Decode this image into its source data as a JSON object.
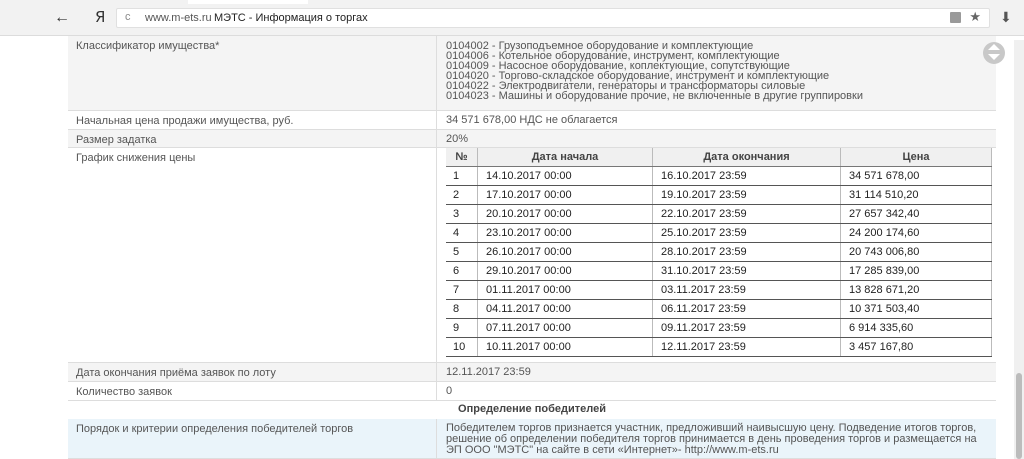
{
  "browser": {
    "back_icon": "←",
    "yandex_logo": "Я",
    "reload_icon": "c",
    "domain": "www.m-ets.ru",
    "title": "МЭТС - Информация о торгах",
    "star_icon": "★",
    "download_icon": "⬇"
  },
  "lot": {
    "classifier_label": "Классификатор имущества*",
    "classifier_items": [
      "0104002 - Грузоподъемное оборудование и комплектующие",
      "0104006 - Котельное оборудование, инструмент, комплектующие",
      "0104009 - Насосное оборудование, коплектующие, сопутствующие",
      "0104020 - Торгово-складское оборудование, инструмент и комплектующие",
      "0104022 - Электродвигатели, генераторы и трансформаторы силовые",
      "0104023 - Машины и оборудование прочие, не включенные в другие группировки"
    ],
    "start_price_label": "Начальная цена продажи имущества, руб.",
    "start_price_value": "34 571 678,00 НДС не облагается",
    "deposit_label": "Размер задатка",
    "deposit_value": "20%",
    "schedule_label": "График снижения цены",
    "schedule_headers": {
      "num": "№",
      "start": "Дата начала",
      "end": "Дата окончания",
      "price": "Цена"
    },
    "schedule": [
      {
        "num": "1",
        "start": "14.10.2017 00:00",
        "end": "16.10.2017 23:59",
        "price": "34 571 678,00"
      },
      {
        "num": "2",
        "start": "17.10.2017 00:00",
        "end": "19.10.2017 23:59",
        "price": "31 114 510,20"
      },
      {
        "num": "3",
        "start": "20.10.2017 00:00",
        "end": "22.10.2017 23:59",
        "price": "27 657 342,40"
      },
      {
        "num": "4",
        "start": "23.10.2017 00:00",
        "end": "25.10.2017 23:59",
        "price": "24 200 174,60"
      },
      {
        "num": "5",
        "start": "26.10.2017 00:00",
        "end": "28.10.2017 23:59",
        "price": "20 743 006,80"
      },
      {
        "num": "6",
        "start": "29.10.2017 00:00",
        "end": "31.10.2017 23:59",
        "price": "17 285 839,00"
      },
      {
        "num": "7",
        "start": "01.11.2017 00:00",
        "end": "03.11.2017 23:59",
        "price": "13 828 671,20"
      },
      {
        "num": "8",
        "start": "04.11.2017 00:00",
        "end": "06.11.2017 23:59",
        "price": "10 371 503,40"
      },
      {
        "num": "9",
        "start": "07.11.2017 00:00",
        "end": "09.11.2017 23:59",
        "price": "6 914 335,60"
      },
      {
        "num": "10",
        "start": "10.11.2017 00:00",
        "end": "12.11.2017 23:59",
        "price": "3 457 167,80"
      }
    ],
    "deadline_label": "Дата окончания приёма заявок по лоту",
    "deadline_value": "12.11.2017 23:59",
    "bids_label": "Количество заявок",
    "bids_value": "0",
    "winners_heading": "Определение победителей",
    "criteria_label": "Порядок и критерии определения победителей торгов",
    "criteria_value": "Победителем торгов признается участник, предложивший наивысшую цену. Подведение итогов торгов, решение об определении победителя торгов принимается в день проведения торгов и размещается на ЭП ООО \"МЭТС\" на сайте в сети «Интернет»- http://www.m-ets.ru"
  }
}
